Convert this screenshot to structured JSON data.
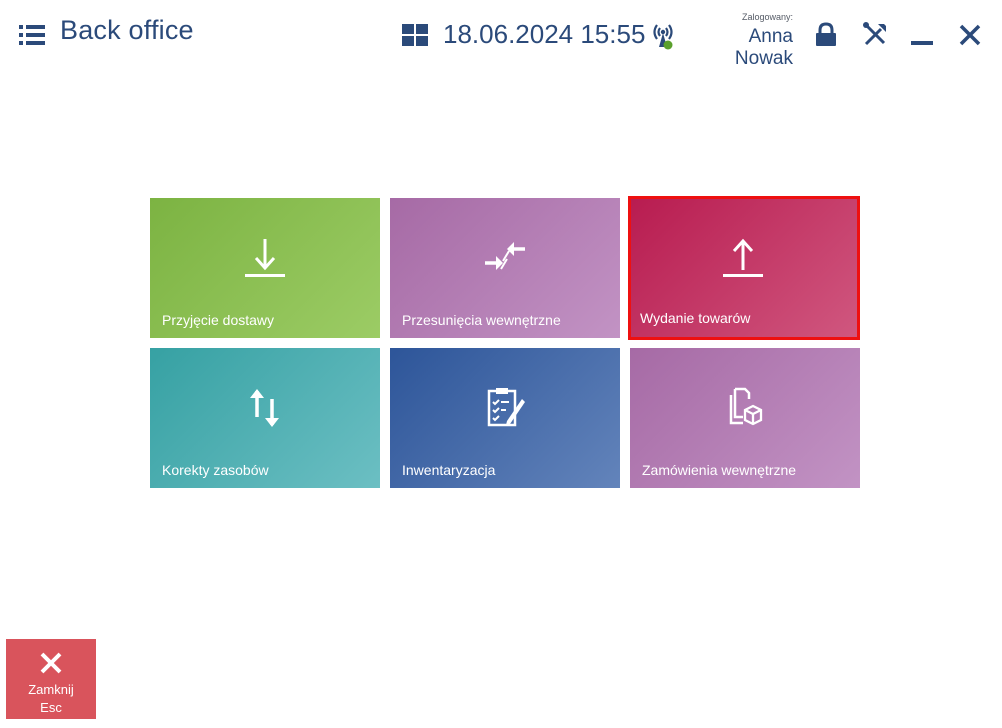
{
  "header": {
    "title": "Back office",
    "datetime": "18.06.2024 15:55",
    "logged_label": "Zalogowany:",
    "user_name": "Anna Nowak"
  },
  "icons": {
    "menu": "hamburger-menu-icon",
    "windows": "windows-icon",
    "connection": "wifi-antenna-icon",
    "lock": "lock-icon",
    "tools": "tools-icon",
    "minimize": "minimize-icon",
    "close": "close-icon"
  },
  "tiles": [
    {
      "label": "Przyjęcie dostawy",
      "icon": "download-arrow-icon",
      "color": "#8bbd52"
    },
    {
      "label": "Przesunięcia wewnętrzne",
      "icon": "transfer-arrows-icon",
      "color": "#b47eb4"
    },
    {
      "label": "Wydanie towarów",
      "icon": "upload-arrow-icon",
      "color": "#c53a66",
      "selected": true
    },
    {
      "label": "Korekty zasobów",
      "icon": "up-down-arrows-icon",
      "color": "#4fb0b3"
    },
    {
      "label": "Inwentaryzacja",
      "icon": "clipboard-checklist-icon",
      "color": "#466ea9"
    },
    {
      "label": "Zamówienia wewnętrzne",
      "icon": "documents-box-icon",
      "color": "#b47eb4"
    }
  ],
  "colors": {
    "header_text": "#2b4a7a",
    "selected_border": "#ee1010",
    "close_button": "#d9545c",
    "status_green": "#5aa02c"
  },
  "footer": {
    "close_label": "Zamknij",
    "close_shortcut": "Esc"
  }
}
